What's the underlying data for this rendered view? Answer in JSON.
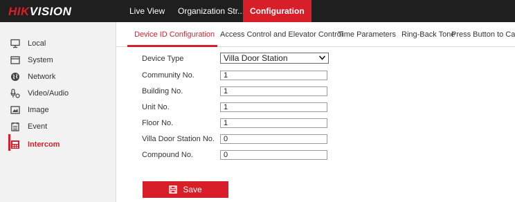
{
  "brand": {
    "logo_red": "HIK",
    "logo_white": "VISION",
    "accent": "#d81e28"
  },
  "topnav": {
    "items": [
      {
        "label": "Live View"
      },
      {
        "label": "Organization Str..."
      },
      {
        "label": "Configuration",
        "active": true
      }
    ]
  },
  "sidebar": {
    "items": [
      {
        "label": "Local",
        "icon": "monitor-icon"
      },
      {
        "label": "System",
        "icon": "system-icon"
      },
      {
        "label": "Network",
        "icon": "globe-icon"
      },
      {
        "label": "Video/Audio",
        "icon": "video-audio-icon"
      },
      {
        "label": "Image",
        "icon": "image-icon"
      },
      {
        "label": "Event",
        "icon": "event-icon"
      },
      {
        "label": "Intercom",
        "icon": "intercom-icon",
        "active": true
      }
    ]
  },
  "tabs": [
    {
      "label": "Device ID Configuration",
      "active": true
    },
    {
      "label": "Access Control and Elevator Control"
    },
    {
      "label": "Time Parameters"
    },
    {
      "label": "Ring-Back Tone"
    },
    {
      "label": "Press Button to Ca"
    }
  ],
  "form": {
    "device_type": {
      "label": "Device Type",
      "value": "Villa Door Station"
    },
    "fields": [
      {
        "label": "Community No.",
        "value": "1"
      },
      {
        "label": "Building No.",
        "value": "1"
      },
      {
        "label": "Unit No.",
        "value": "1"
      },
      {
        "label": "Floor No.",
        "value": "1"
      },
      {
        "label": "Villa Door Station No.",
        "value": "0"
      },
      {
        "label": "Compound No.",
        "value": "0"
      }
    ]
  },
  "save_button": {
    "label": "Save",
    "icon": "floppy-disk-icon"
  }
}
